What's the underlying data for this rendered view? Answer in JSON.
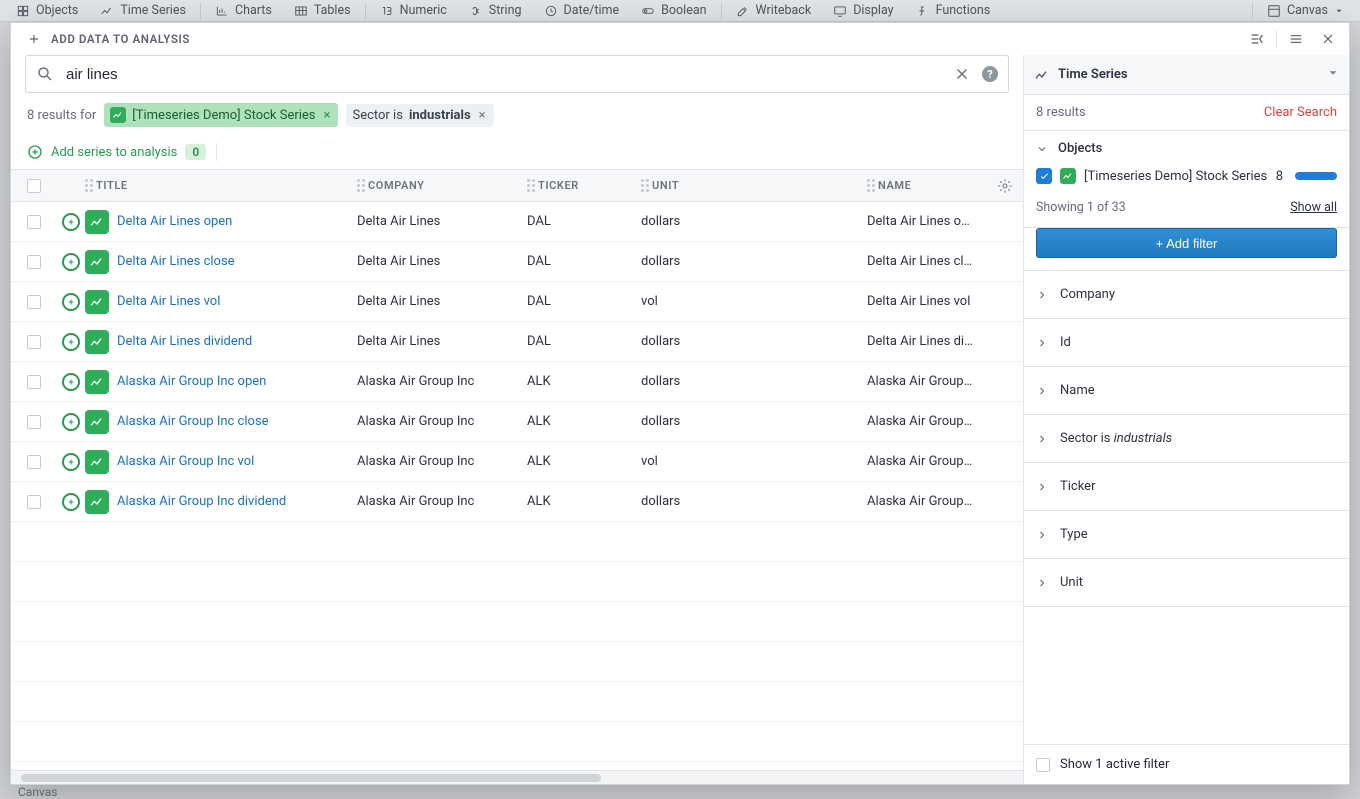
{
  "ribbon": {
    "items": [
      {
        "label": "Objects"
      },
      {
        "label": "Time Series"
      },
      {
        "label": "Charts"
      },
      {
        "label": "Tables"
      },
      {
        "label": "Numeric"
      },
      {
        "label": "String"
      },
      {
        "label": "Date/time"
      },
      {
        "label": "Boolean"
      },
      {
        "label": "Writeback"
      },
      {
        "label": "Display"
      },
      {
        "label": "Functions"
      }
    ],
    "canvas_label": "Canvas"
  },
  "header": {
    "add_data": "ADD DATA TO ANALYSIS"
  },
  "search": {
    "query": "air lines",
    "clear": "×",
    "placeholder": ""
  },
  "results_meta": {
    "prefix": "8 results for",
    "source_chip": "[Timeseries Demo] Stock Series",
    "sector_chip_prefix": "Sector is ",
    "sector_chip_value": "industrials"
  },
  "add_series": {
    "label": "Add series to analysis",
    "count": "0"
  },
  "table": {
    "columns": [
      "TITLE",
      "COMPANY",
      "TICKER",
      "UNIT",
      "NAME"
    ],
    "rows": [
      {
        "title": "Delta Air Lines open",
        "company": "Delta Air Lines",
        "ticker": "DAL",
        "unit": "dollars",
        "name": "Delta Air Lines open"
      },
      {
        "title": "Delta Air Lines close",
        "company": "Delta Air Lines",
        "ticker": "DAL",
        "unit": "dollars",
        "name": "Delta Air Lines close"
      },
      {
        "title": "Delta Air Lines vol",
        "company": "Delta Air Lines",
        "ticker": "DAL",
        "unit": "vol",
        "name": "Delta Air Lines vol"
      },
      {
        "title": "Delta Air Lines dividend",
        "company": "Delta Air Lines",
        "ticker": "DAL",
        "unit": "dollars",
        "name": "Delta Air Lines dividend"
      },
      {
        "title": "Alaska Air Group Inc open",
        "company": "Alaska Air Group Inc",
        "ticker": "ALK",
        "unit": "dollars",
        "name": "Alaska Air Group Inc open"
      },
      {
        "title": "Alaska Air Group Inc close",
        "company": "Alaska Air Group Inc",
        "ticker": "ALK",
        "unit": "dollars",
        "name": "Alaska Air Group Inc close"
      },
      {
        "title": "Alaska Air Group Inc vol",
        "company": "Alaska Air Group Inc",
        "ticker": "ALK",
        "unit": "vol",
        "name": "Alaska Air Group Inc vol"
      },
      {
        "title": "Alaska Air Group Inc dividend",
        "company": "Alaska Air Group Inc",
        "ticker": "ALK",
        "unit": "dollars",
        "name": "Alaska Air Group Inc dividend"
      }
    ]
  },
  "side": {
    "title": "Time Series",
    "results": "8 results",
    "clear": "Clear Search",
    "objects_heading": "Objects",
    "object_item": "[Timeseries Demo] Stock Series",
    "object_count": "8",
    "showing": "Showing 1 of 33",
    "show_all": "Show all",
    "add_filter": "+ Add filter",
    "filters": [
      "Company",
      "Id",
      "Name",
      "Sector is <em>industrials</em>",
      "Ticker",
      "Type",
      "Unit"
    ],
    "footer": "Show 1 active filter"
  },
  "bottom_tab": "Canvas"
}
